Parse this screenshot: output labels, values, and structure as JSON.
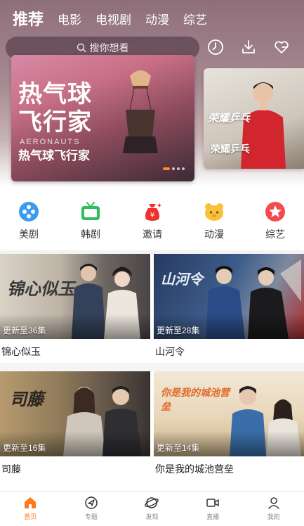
{
  "nav": {
    "tabs": [
      {
        "label": "推荐",
        "active": true
      },
      {
        "label": "电影"
      },
      {
        "label": "电视剧"
      },
      {
        "label": "动漫"
      },
      {
        "label": "综艺"
      }
    ]
  },
  "search": {
    "placeholder": "搜你想看",
    "icons": [
      "search-icon",
      "history-icon",
      "download-icon",
      "favorite-icon"
    ]
  },
  "banners": [
    {
      "title_art": "热气球飞行家",
      "subtitle": "AERONAUTS",
      "caption": "热气球飞行家",
      "page_count": 4,
      "active_page": 1
    },
    {
      "title_art": "荣耀乒乓",
      "caption": "荣耀乒乓"
    }
  ],
  "categories": [
    {
      "label": "美剧",
      "icon": "american-drama-icon",
      "color": "#3a9bf0"
    },
    {
      "label": "韩剧",
      "icon": "tv-icon",
      "color": "#2fbf5a"
    },
    {
      "label": "邀请",
      "icon": "invite-money-bag-icon",
      "color": "#f0302f"
    },
    {
      "label": "动漫",
      "icon": "anime-bear-icon",
      "color": "#f7c23a"
    },
    {
      "label": "综艺",
      "icon": "variety-star-icon",
      "color": "#f5484f"
    }
  ],
  "shows": [
    {
      "title": "锦心似玉",
      "episode": "更新至36集",
      "poster_text": "锦心似玉"
    },
    {
      "title": "山河令",
      "episode": "更新至28集",
      "poster_text": "山河令"
    },
    {
      "title": "司藤",
      "episode": "更新至16集",
      "poster_text": "司藤"
    },
    {
      "title": "你是我的城池营垒",
      "episode": "更新至14集",
      "poster_text": "你是我的城池营垒"
    }
  ],
  "bottom_nav": [
    {
      "label": "首页",
      "icon": "home-icon",
      "active": true
    },
    {
      "label": "专题",
      "icon": "topic-icon"
    },
    {
      "label": "发现",
      "icon": "discover-icon"
    },
    {
      "label": "直播",
      "icon": "live-icon"
    },
    {
      "label": "我的",
      "icon": "profile-icon"
    }
  ],
  "colors": {
    "accent": "#ff7a1a",
    "header_bg": "#9a7b86"
  }
}
